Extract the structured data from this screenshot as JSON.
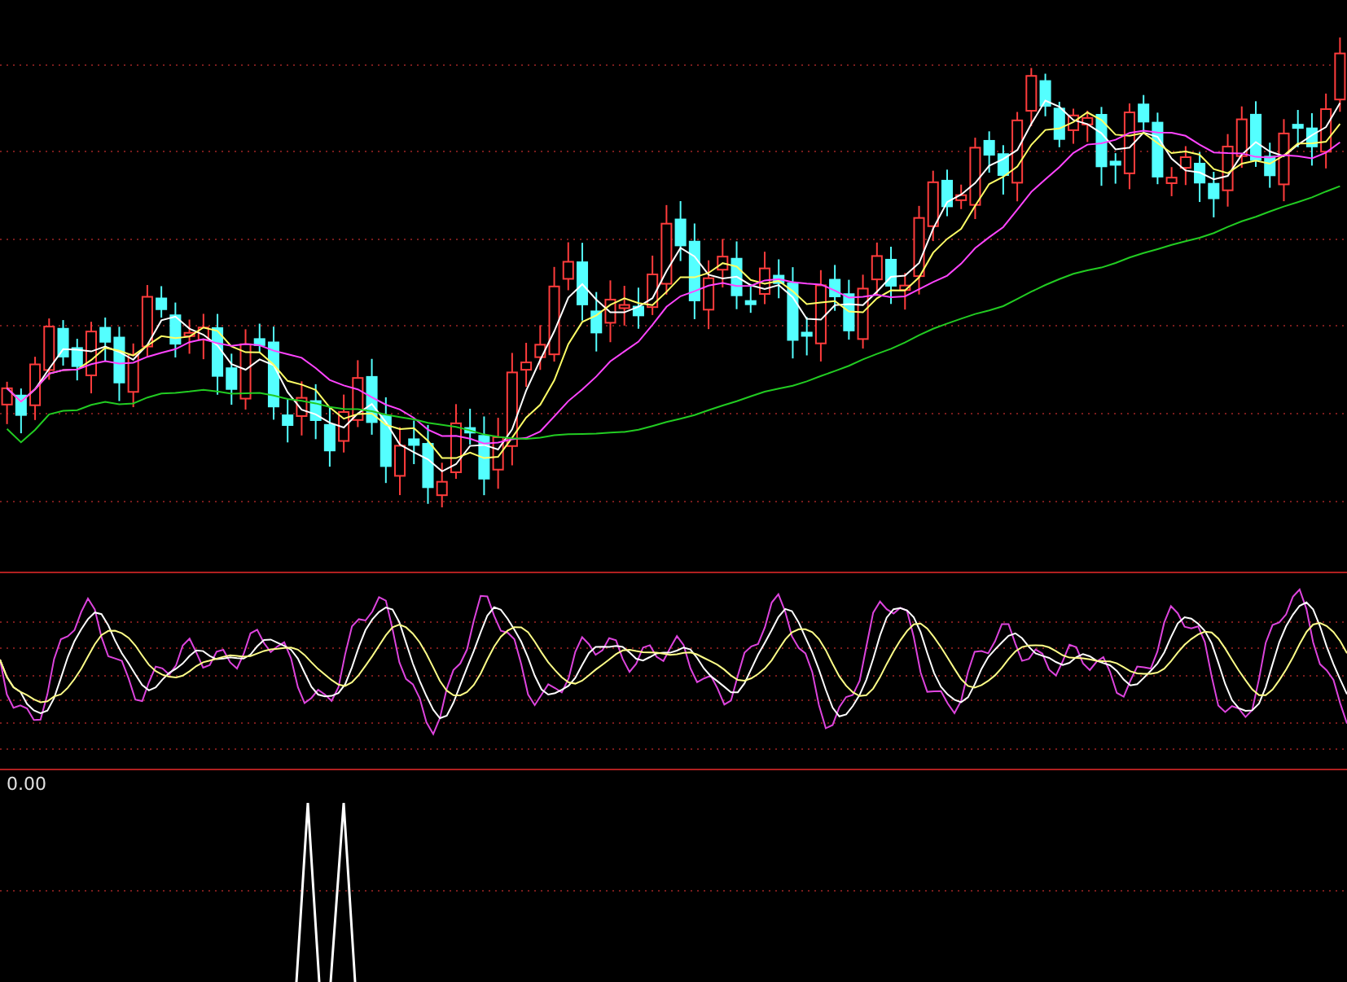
{
  "indicator_panel": {
    "reading": "0.00"
  }
}
